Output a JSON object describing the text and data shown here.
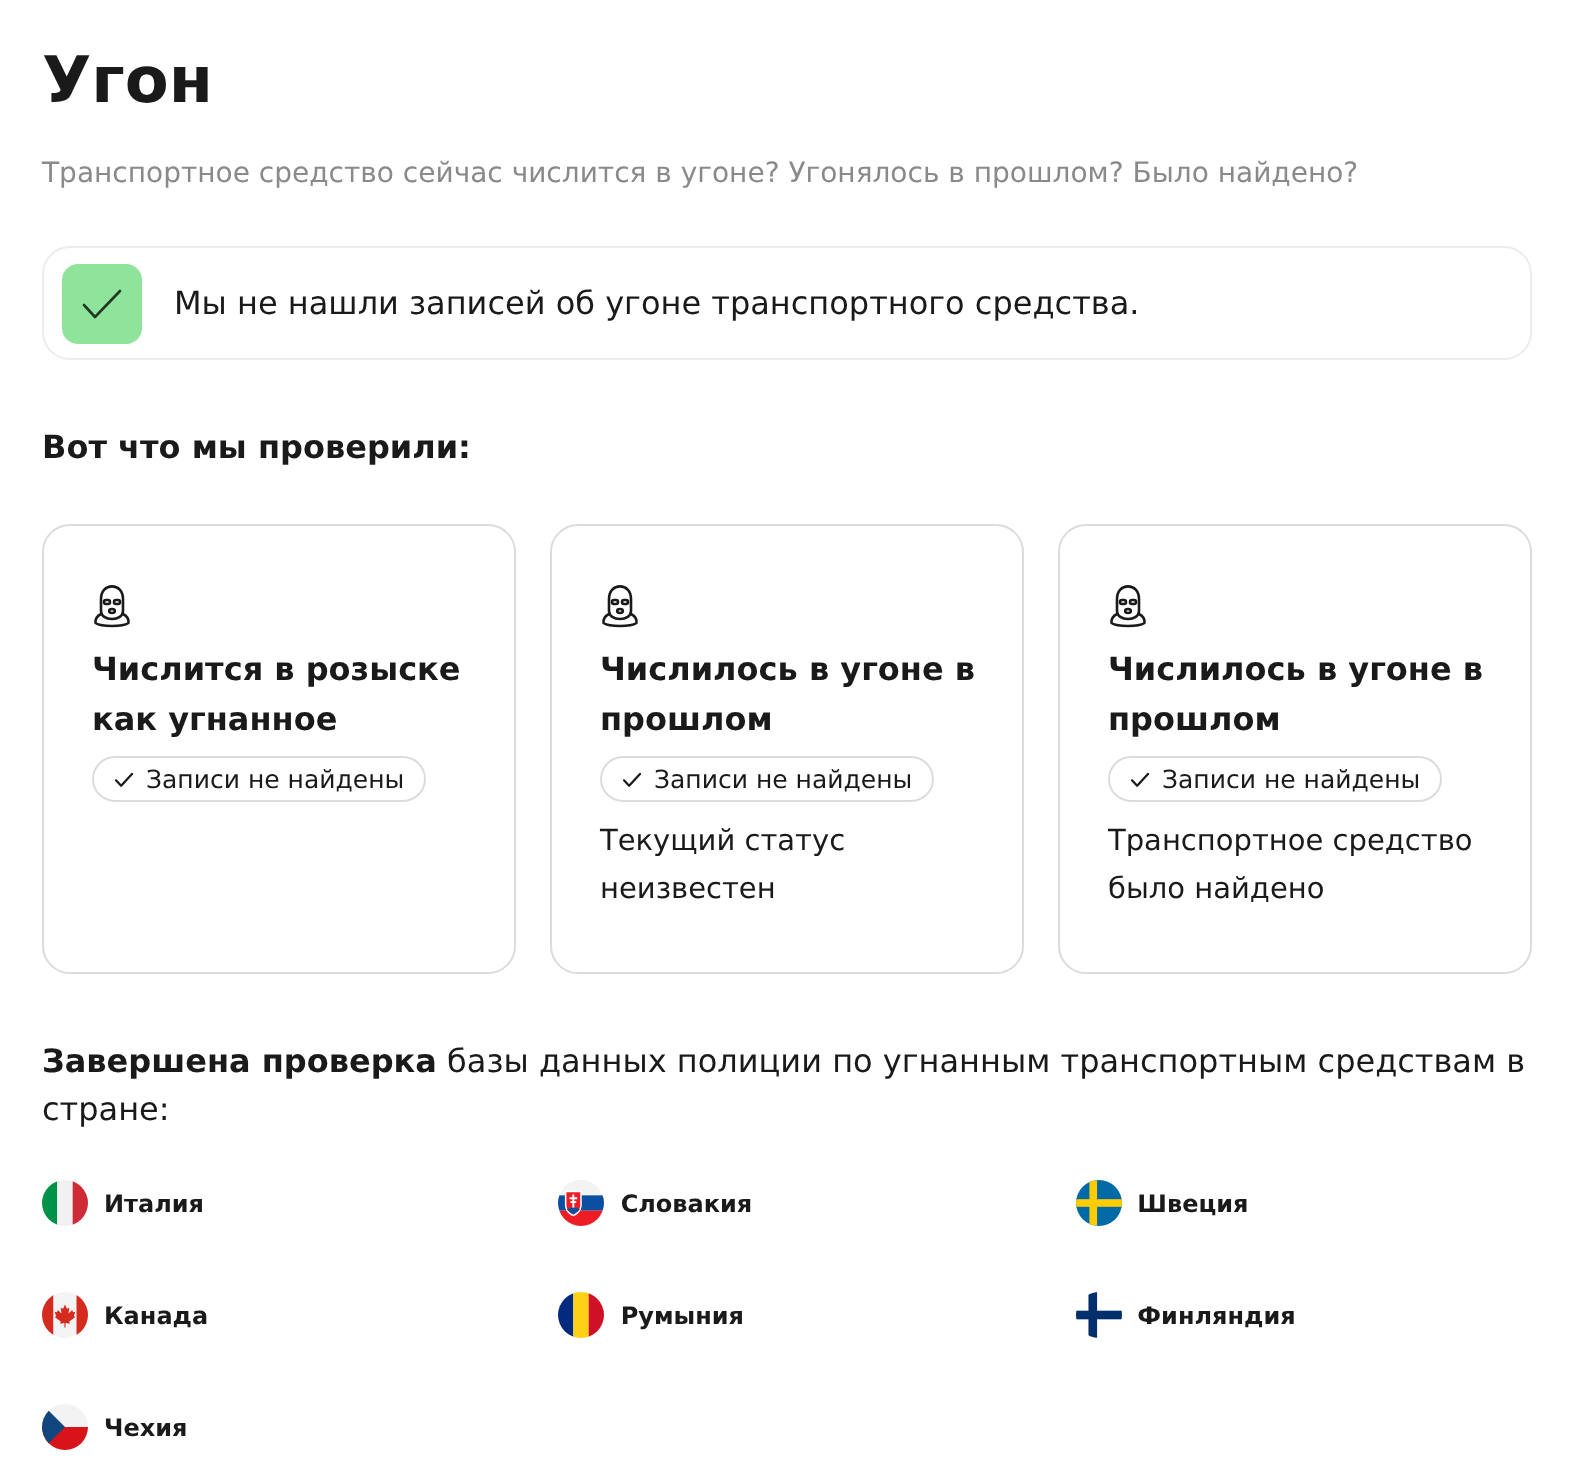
{
  "title": "Угон",
  "subtitle": "Транспортное средство сейчас числится в угоне? Угонялось в прошлом? Было найдено?",
  "alert": {
    "text": "Мы не нашли записей об угоне транспортного средства."
  },
  "checks_heading": "Вот что мы проверили:",
  "checks": [
    {
      "title": "Числится в розыске как угнанное",
      "badge": "Записи не найдены"
    },
    {
      "title": "Числилось в угоне в прошлом",
      "badge": "Записи не найдены",
      "description": "Текущий статус неизвестен"
    },
    {
      "title": "Числилось в угоне в прошлом",
      "badge": "Записи не найдены",
      "description": "Транспортное средство было найдено"
    }
  ],
  "countries_intro": "**Завершена проверка** базы данных полиции по угнанным транспортным средствам в стране:",
  "countries": [
    {
      "name": "Италия",
      "kind": "it"
    },
    {
      "name": "Словакия",
      "kind": "sk"
    },
    {
      "name": "Швеция",
      "kind": "se"
    },
    {
      "name": "Канада",
      "kind": "ca"
    },
    {
      "name": "Румыния",
      "kind": "ro"
    },
    {
      "name": "Финляндия",
      "kind": "fi"
    },
    {
      "name": "Чехия",
      "kind": "cz"
    }
  ]
}
